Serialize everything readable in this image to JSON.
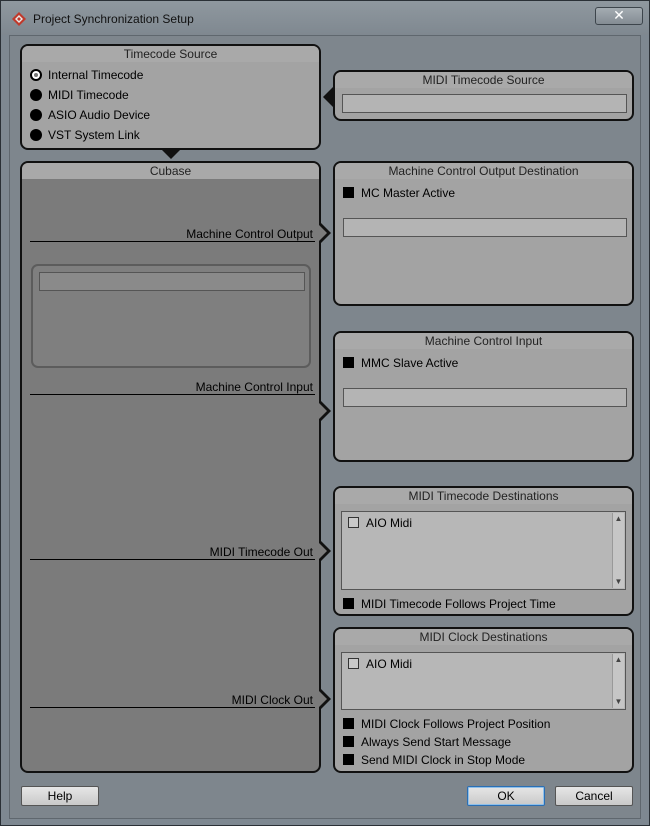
{
  "window": {
    "title": "Project Synchronization Setup",
    "close_glyph": "✕",
    "icon": "cubase-logo-icon"
  },
  "timecode_source": {
    "header": "Timecode Source",
    "options": [
      {
        "label": "Internal Timecode",
        "selected": true
      },
      {
        "label": "MIDI Timecode",
        "selected": false
      },
      {
        "label": "ASIO Audio Device",
        "selected": false
      },
      {
        "label": "VST System Link",
        "selected": false
      }
    ]
  },
  "midi_timecode_source": {
    "header": "MIDI Timecode Source",
    "value": ""
  },
  "cubase": {
    "header": "Cubase",
    "field_value": "",
    "connections": [
      "Machine Control Output",
      "Machine Control Input",
      "MIDI Timecode Out",
      "MIDI Clock Out"
    ]
  },
  "mc_output": {
    "header": "Machine Control Output Destination",
    "checkbox_label": "MC Master Active",
    "checked": false,
    "value": ""
  },
  "mc_input": {
    "header": "Machine Control Input",
    "checkbox_label": "MMC Slave Active",
    "checked": false,
    "value": ""
  },
  "midi_timecode_destinations": {
    "header": "MIDI Timecode Destinations",
    "items": [
      {
        "label": "AIO Midi",
        "checked": false
      }
    ],
    "follow_label": "MIDI Timecode Follows Project Time"
  },
  "midi_clock_destinations": {
    "header": "MIDI Clock Destinations",
    "items": [
      {
        "label": "AIO Midi",
        "checked": false
      }
    ],
    "options": [
      "MIDI Clock Follows Project Position",
      "Always Send Start Message",
      "Send MIDI Clock in Stop Mode"
    ]
  },
  "buttons": {
    "help": "Help",
    "ok": "OK",
    "cancel": "Cancel"
  },
  "scroll": {
    "up_glyph": "▲",
    "down_glyph": "▼"
  }
}
